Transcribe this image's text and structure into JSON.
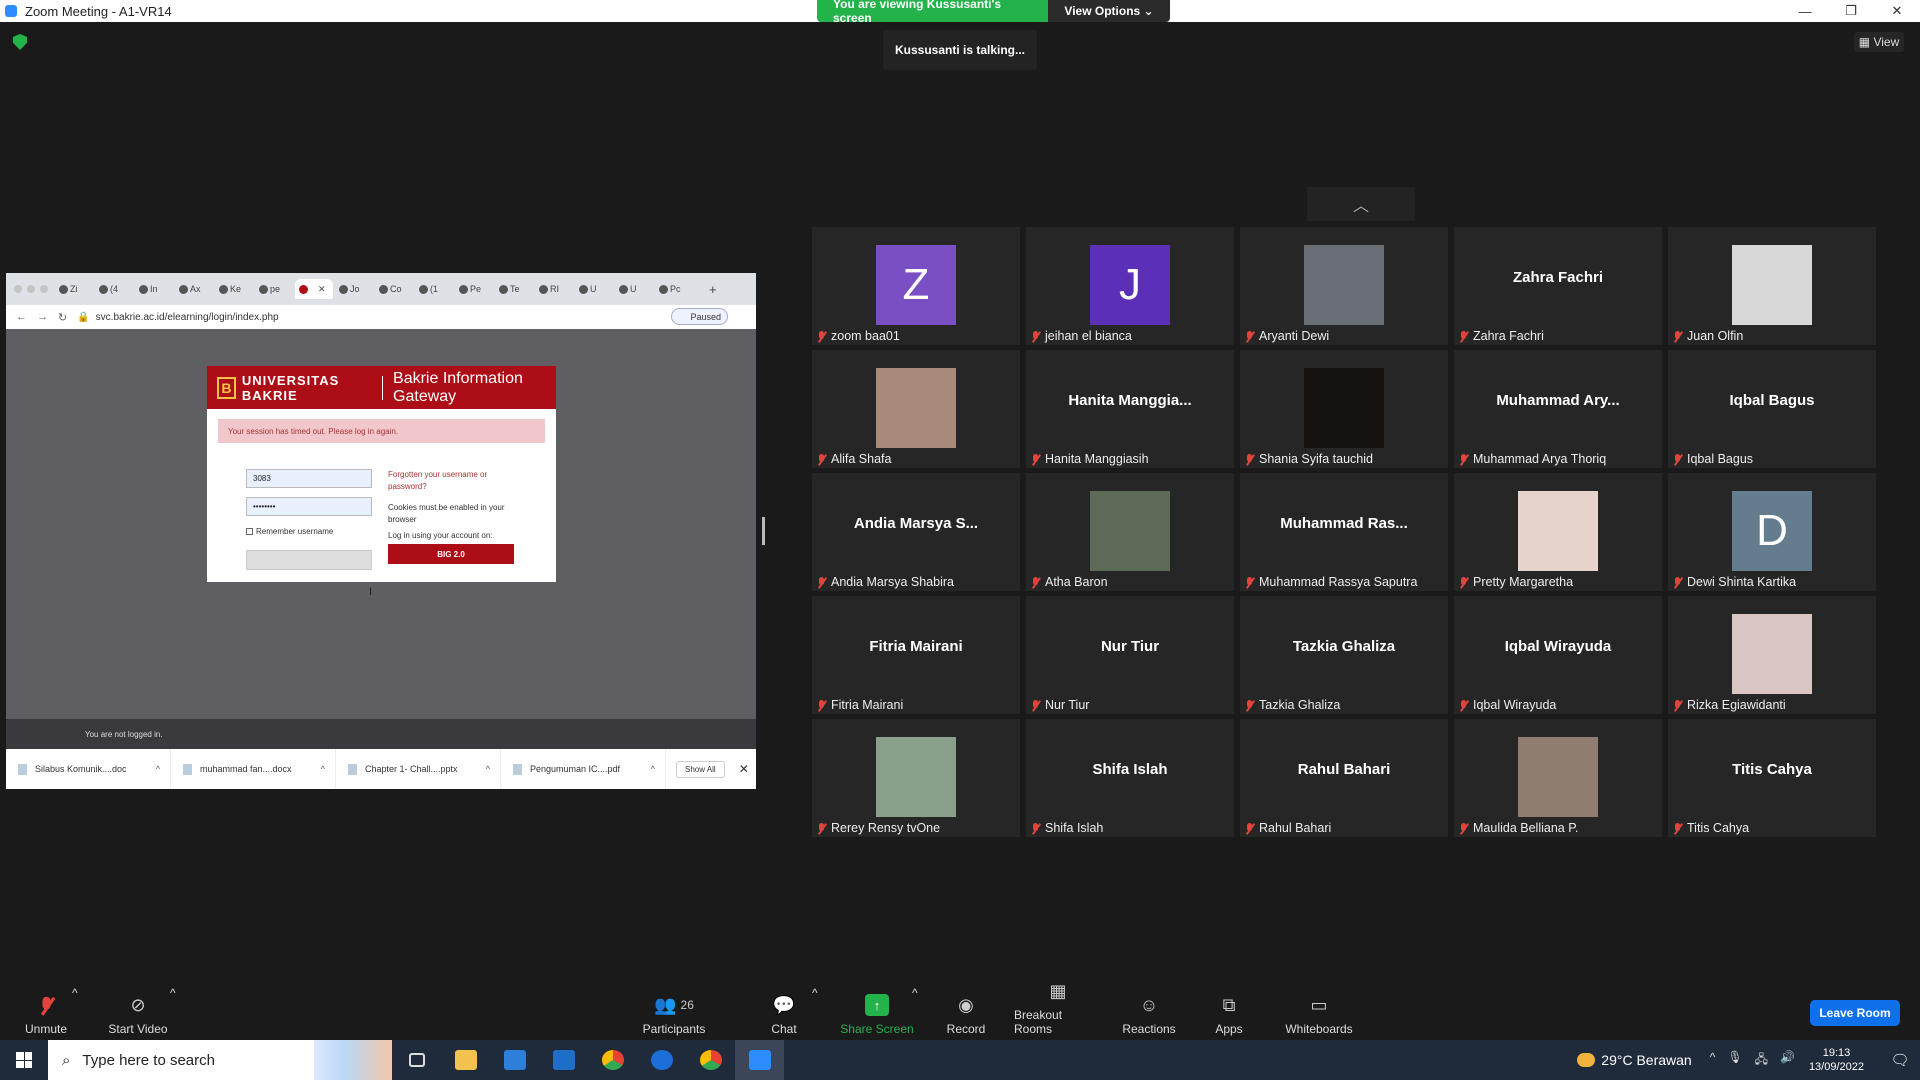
{
  "window": {
    "title": "Zoom Meeting - A1-VR14"
  },
  "share_banner": {
    "viewing": "You are viewing Kussusanti's screen",
    "options": "View Options ⌄"
  },
  "talking": "Kussusanti is talking...",
  "view_button": "View",
  "shared_screen": {
    "tabs": [
      "Zi",
      "(4",
      "In",
      "Ax",
      "Ke",
      "pe",
      "",
      "Jo",
      "Co",
      "(1",
      "Pe",
      "Te",
      "RI",
      "U",
      "U",
      "Pc"
    ],
    "url": "svc.bakrie.ac.id/elearning/login/index.php",
    "paused": "Paused",
    "logo_text": "UNIVERSITAS BAKRIE",
    "logo_letter": "B",
    "gateway_title": "Bakrie Information Gateway",
    "timeout_msg": "Your session has timed out. Please log in again.",
    "username_value": "3083",
    "password_value": "••••••••",
    "forgot": "Forgotten your username or password?",
    "cookies": "Cookies must be enabled in your browser",
    "remember": "Remember username",
    "login_using": "Log in using your account on:",
    "big_button": "BIG 2.0",
    "not_logged": "You are not logged in.",
    "downloads": [
      {
        "name": "Silabus Komunik....doc"
      },
      {
        "name": "muhammad fan....docx"
      },
      {
        "name": "Chapter 1- Chall....pptx"
      },
      {
        "name": "Pengumuman IC....pdf"
      }
    ],
    "show_all": "Show All",
    "close": "✕"
  },
  "participants": [
    {
      "name": "zoom baa01",
      "type": "letter",
      "letter": "Z",
      "color": "#7a4fc4"
    },
    {
      "name": "jeihan el bianca",
      "type": "letter",
      "letter": "J",
      "color": "#5b2fb8"
    },
    {
      "name": "Aryanti Dewi",
      "type": "photo",
      "color": "#6a6f75"
    },
    {
      "name": "Zahra Fachri",
      "type": "name",
      "display": "Zahra Fachri"
    },
    {
      "name": "Juan Olfin",
      "type": "photo",
      "color": "#d8d8d8"
    },
    {
      "name": "Alifa Shafa",
      "type": "photo",
      "color": "#a88a78"
    },
    {
      "name": "Hanita Manggiasih",
      "type": "name",
      "display": "Hanita  Manggia..."
    },
    {
      "name": "Shania Syifa tauchid",
      "type": "photo",
      "color": "#161210"
    },
    {
      "name": "Muhammad Arya Thoriq",
      "type": "name",
      "display": "Muhammad  Ary..."
    },
    {
      "name": "Iqbal Bagus",
      "type": "name",
      "display": "Iqbal Bagus"
    },
    {
      "name": "Andia Marsya Shabira",
      "type": "name",
      "display": "Andia  Marsya  S..."
    },
    {
      "name": "Atha Baron",
      "type": "photo",
      "color": "#5d6a57"
    },
    {
      "name": "Muhammad Rassya Saputra",
      "type": "name",
      "display": "Muhammad  Ras..."
    },
    {
      "name": "Pretty Margaretha",
      "type": "photo",
      "color": "#e6d4cc"
    },
    {
      "name": "Dewi Shinta Kartika",
      "type": "letter",
      "letter": "D",
      "color": "#637d8f"
    },
    {
      "name": "Fitria Mairani",
      "type": "name",
      "display": "Fitria Mairani"
    },
    {
      "name": "Nur Tiur",
      "type": "name",
      "display": "Nur Tiur"
    },
    {
      "name": "Tazkia Ghaliza",
      "type": "name",
      "display": "Tazkia Ghaliza"
    },
    {
      "name": "Iqbal Wirayuda",
      "type": "name",
      "display": "Iqbal Wirayuda"
    },
    {
      "name": "Rizka Egiawidanti",
      "type": "photo",
      "color": "#d9c6c2"
    },
    {
      "name": "Rerey Rensy tvOne",
      "type": "photo",
      "color": "#8aa08a"
    },
    {
      "name": "Shifa Islah",
      "type": "name",
      "display": "Shifa Islah"
    },
    {
      "name": "Rahul Bahari",
      "type": "name",
      "display": "Rahul Bahari"
    },
    {
      "name": "Maulida Belliana P.",
      "type": "photo",
      "color": "#8f7d72"
    },
    {
      "name": "Titis Cahya",
      "type": "name",
      "display": "Titis Cahya"
    }
  ],
  "toolbar": {
    "unmute": "Unmute",
    "start_video": "Start Video",
    "participants": "Participants",
    "participants_count": "26",
    "chat": "Chat",
    "share_screen": "Share Screen",
    "record": "Record",
    "breakout": "Breakout Rooms",
    "reactions": "Reactions",
    "apps": "Apps",
    "whiteboards": "Whiteboards",
    "leave": "Leave Room"
  },
  "taskbar": {
    "search_placeholder": "Type here to search",
    "weather": "29°C  Berawan",
    "time": "19:13",
    "date": "13/09/2022"
  }
}
